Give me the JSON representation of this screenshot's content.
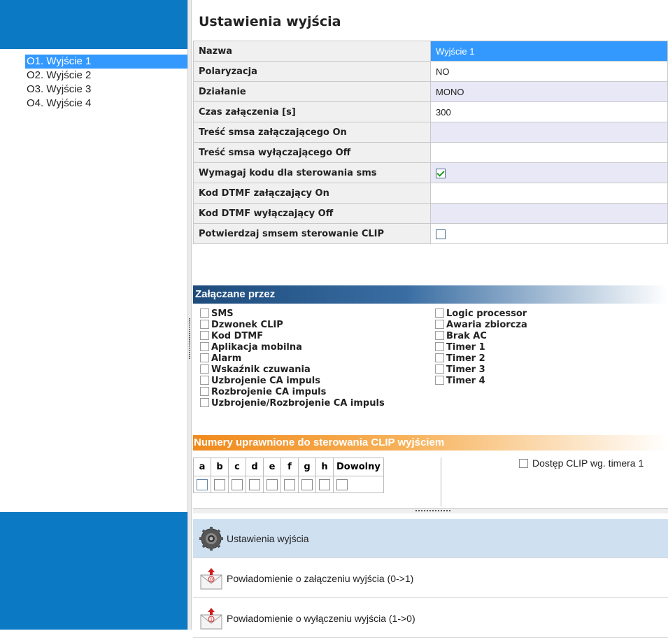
{
  "outputs": {
    "items": [
      {
        "label": "O1. Wyjście 1",
        "selected": true
      },
      {
        "label": "O2. Wyjście 2",
        "selected": false
      },
      {
        "label": "O3. Wyjście 3",
        "selected": false
      },
      {
        "label": "O4. Wyjście 4",
        "selected": false
      }
    ]
  },
  "settings": {
    "title": "Ustawienia wyjścia",
    "rows": [
      {
        "label": "Nazwa",
        "value": "Wyjście 1"
      },
      {
        "label": "Polaryzacja",
        "value": "NO"
      },
      {
        "label": "Działanie",
        "value": "MONO"
      },
      {
        "label": "Czas załączenia [s]",
        "value": "300"
      },
      {
        "label": "Treść smsa załączającego On",
        "value": ""
      },
      {
        "label": "Treść smsa wyłączającego Off",
        "value": ""
      },
      {
        "label": "Wymagaj kodu dla sterowania sms",
        "checked": true
      },
      {
        "label": "Kod DTMF załączający On",
        "value": ""
      },
      {
        "label": "Kod DTMF wyłączający Off",
        "value": ""
      },
      {
        "label": "Potwierdzaj smsem sterowanie CLIP",
        "checked": false
      }
    ]
  },
  "enabled_by": {
    "header": "Załączane przez",
    "left": [
      "SMS",
      "Dzwonek CLIP",
      "Kod DTMF",
      "Aplikacja mobilna",
      "Alarm",
      "Wskaźnik czuwania",
      "Uzbrojenie CA impuls",
      "Rozbrojenie CA impuls",
      "Uzbrojenie/Rozbrojenie CA impuls"
    ],
    "right": [
      "Logic processor",
      "Awaria zbiorcza",
      "Brak AC",
      "Timer 1",
      "Timer 2",
      "Timer 3",
      "Timer 4"
    ]
  },
  "clip": {
    "header": "Numery uprawnione do sterowania CLIP wyjściem",
    "columns": [
      "a",
      "b",
      "c",
      "d",
      "e",
      "f",
      "g",
      "h",
      "Dowolny"
    ],
    "timer_label": "Dostęp CLIP wg. timera 1"
  },
  "nav": {
    "settings": "Ustawienia wyjścia",
    "notify_on": "Powiadomienie o załączeniu wyjścia (0->1)",
    "notify_off": "Powiadomienie o wyłączeniu wyjścia (1->0)"
  },
  "colors": {
    "accent_blue": "#0c79c4",
    "selection": "#3399ff",
    "checkmark": "#1f9a1f",
    "orange_header": "#f08a1c"
  }
}
